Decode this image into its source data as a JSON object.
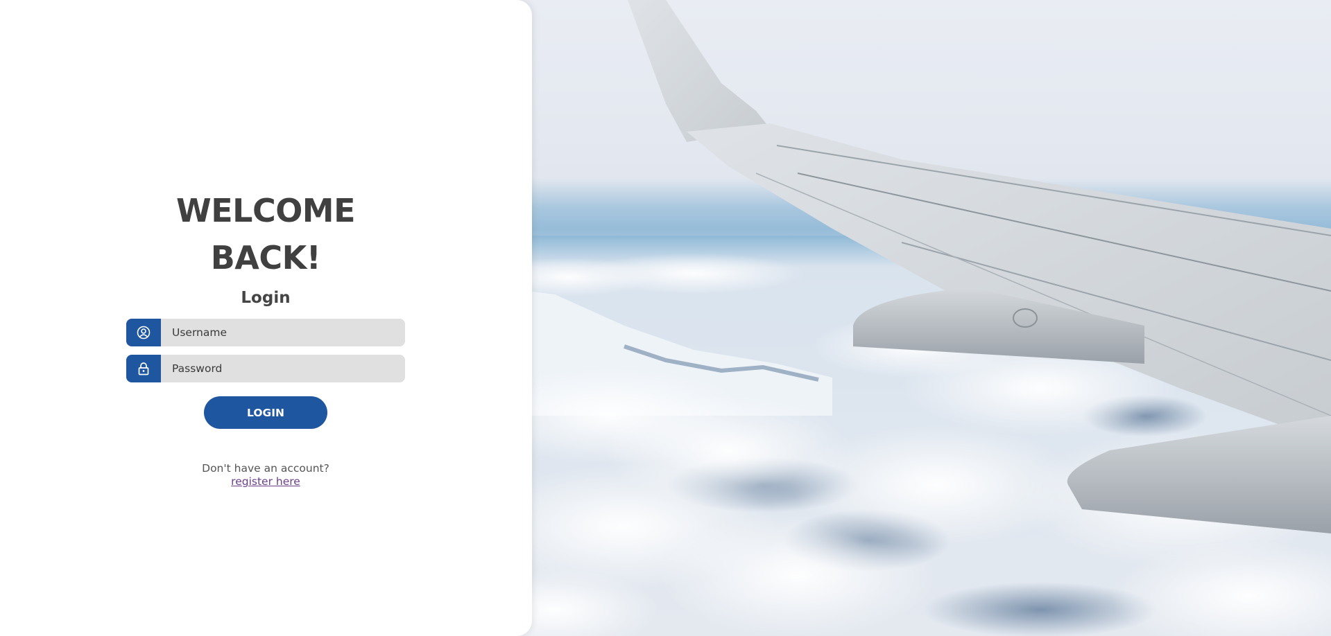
{
  "login": {
    "heading": "WELCOME BACK!",
    "subtitle": "Login",
    "username_placeholder": "Username",
    "password_placeholder": "Password",
    "button_label": "LOGIN",
    "no_account_text": "Don't have an account?",
    "register_link": "register here"
  },
  "icons": {
    "username": "user-circle-icon",
    "password": "lock-icon"
  },
  "colors": {
    "accent": "#1e56a0",
    "heading": "#404040",
    "field_bg": "#e0e0e0",
    "link": "#6b3f8a"
  }
}
